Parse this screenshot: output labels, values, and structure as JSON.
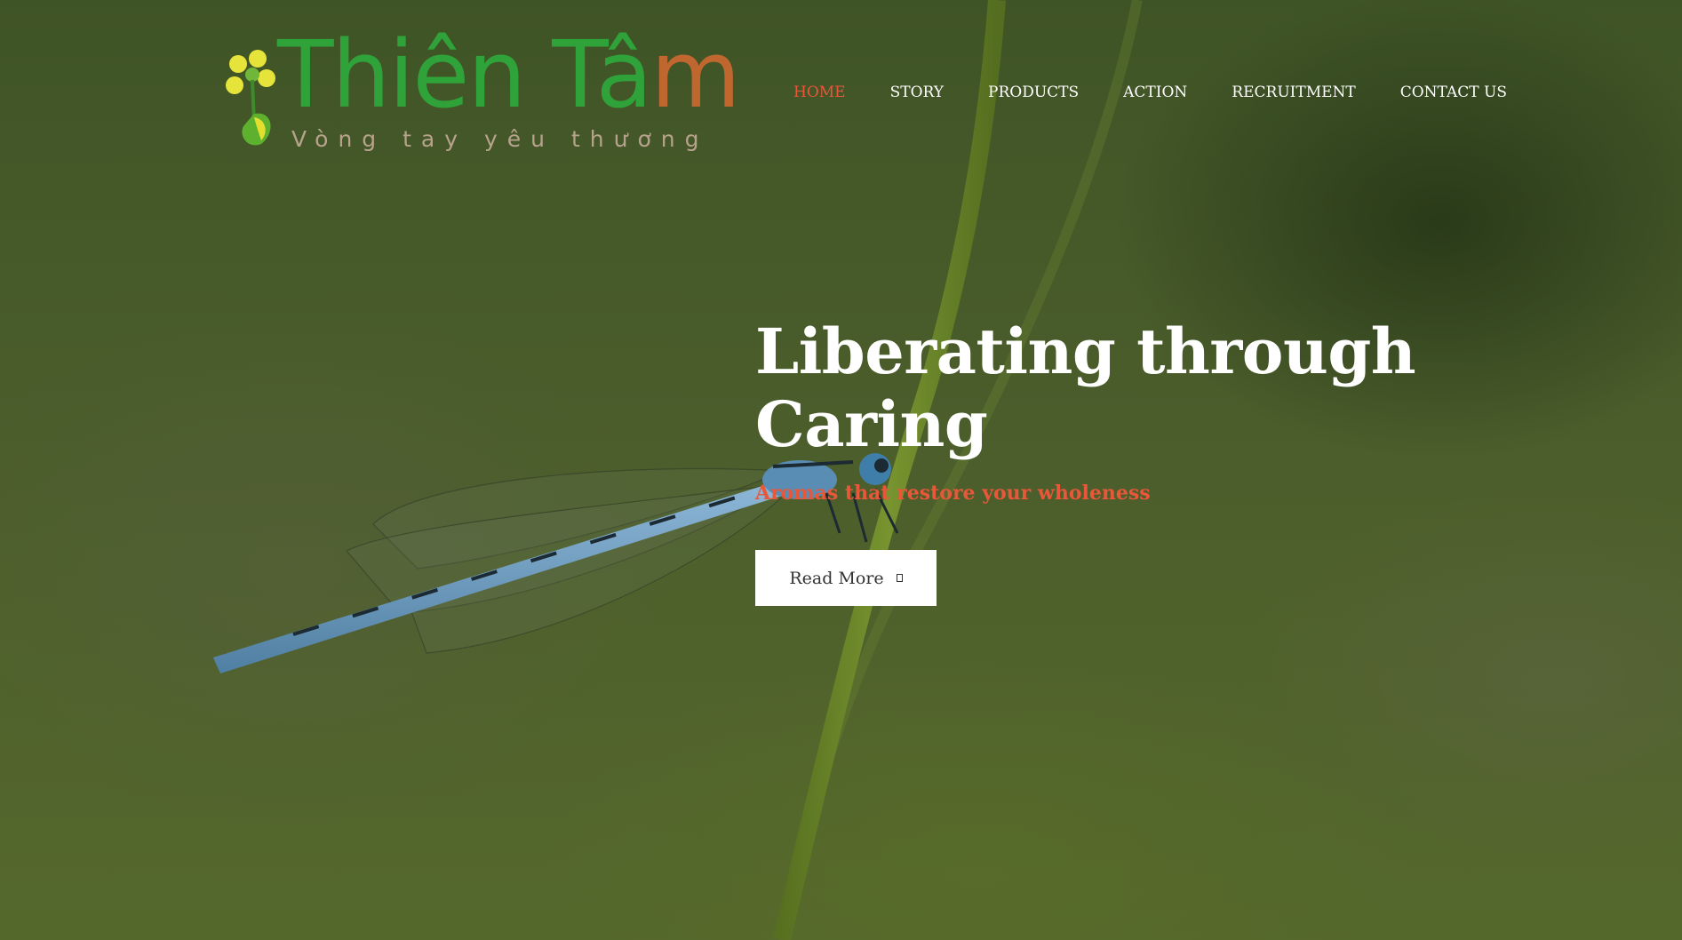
{
  "logo": {
    "brand_part1": "Thiên Tâ",
    "brand_part2": "m",
    "tagline": "Vòng tay yêu thương",
    "icon": "flower-logo-icon"
  },
  "nav": {
    "items": [
      {
        "label": "HOME",
        "active": true
      },
      {
        "label": "STORY",
        "active": false
      },
      {
        "label": "PRODUCTS",
        "active": false
      },
      {
        "label": "ACTION",
        "active": false
      },
      {
        "label": "RECRUITMENT",
        "active": false
      },
      {
        "label": "CONTACT US",
        "active": false
      }
    ]
  },
  "hero": {
    "headline_line1": "Liberating through",
    "headline_line2": "Caring",
    "subheadline": "Aromas that restore your wholeness",
    "button_label": "Read More",
    "button_icon": "arrow-icon",
    "image_subject": "dragonfly-on-grass-stem"
  },
  "colors": {
    "accent": "#e8573a",
    "brand_green": "#2fa23a",
    "brand_orange": "#c0672f",
    "text_light": "#ffffff"
  }
}
